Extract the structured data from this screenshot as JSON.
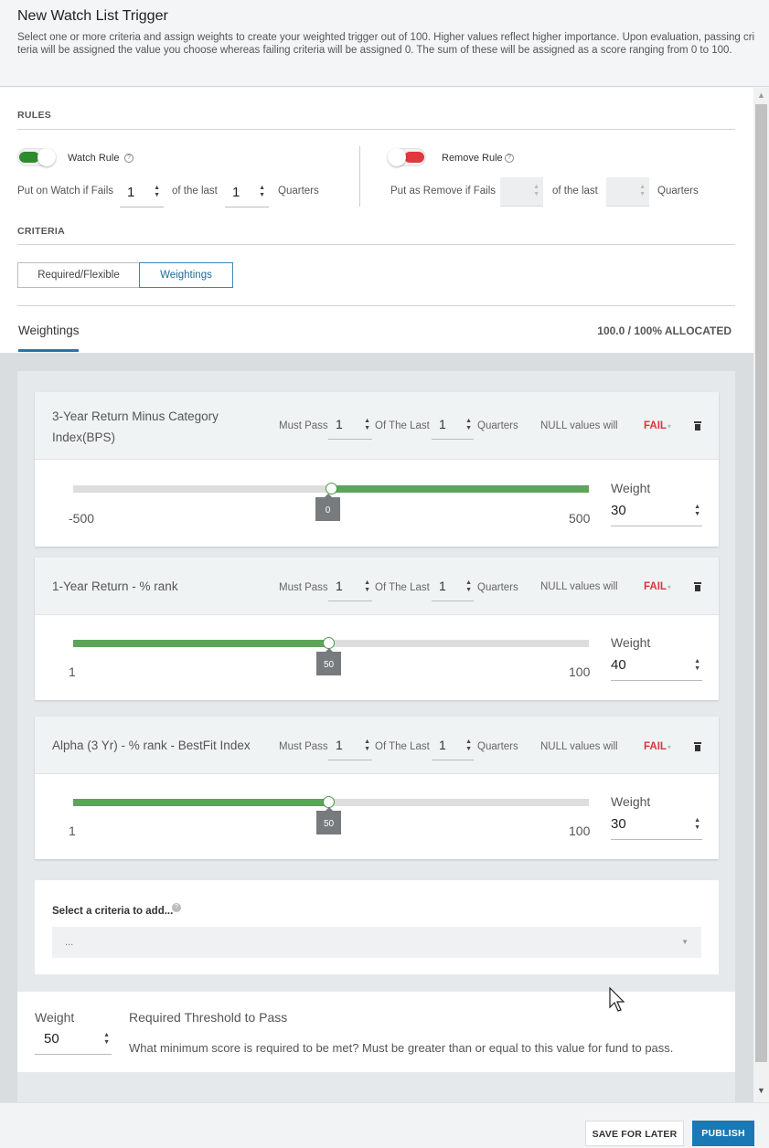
{
  "header": {
    "title": "New Watch List Trigger",
    "description": "Select one or more criteria and assign weights to create your weighted trigger out of 100. Higher values reflect higher importance. Upon evaluation, passing criteria will be assigned the value you choose whereas failing criteria will be assigned 0. The sum of these will be assigned as a score ranging from 0 to 100."
  },
  "rules": {
    "section_label": "RULES",
    "watch": {
      "label": "Watch Rule",
      "enabled": true,
      "prefix": "Put on Watch if Fails",
      "fails": "1",
      "middle": "of the last",
      "last": "1",
      "suffix": "Quarters"
    },
    "remove": {
      "label": "Remove Rule",
      "enabled": false,
      "prefix": "Put as Remove if Fails",
      "fails": "",
      "middle": "of the last",
      "last": "",
      "suffix": "Quarters"
    }
  },
  "criteria": {
    "section_label": "CRITERIA",
    "tabs": [
      "Required/Flexible",
      "Weightings"
    ],
    "active_tab": "Weightings"
  },
  "weightings": {
    "tab_label": "Weightings",
    "allocated": "100.0 / 100% ALLOCATED",
    "must_pass_label": "Must Pass",
    "of_the_last_label": "Of The Last",
    "quarters_label": "Quarters",
    "null_label": "NULL values will",
    "weight_label": "Weight",
    "items": [
      {
        "title": "3-Year Return Minus Category Index(BPS)",
        "must_pass": "1",
        "of_last": "1",
        "null_action": "FAIL",
        "min": "-500",
        "max": "500",
        "value": "0",
        "weight": "30"
      },
      {
        "title": "1-Year Return - % rank",
        "must_pass": "1",
        "of_last": "1",
        "null_action": "FAIL",
        "min": "1",
        "max": "100",
        "value": "50",
        "weight": "40"
      },
      {
        "title": "Alpha (3 Yr) - % rank - BestFit Index",
        "must_pass": "1",
        "of_last": "1",
        "null_action": "FAIL",
        "min": "1",
        "max": "100",
        "value": "50",
        "weight": "30"
      }
    ],
    "add": {
      "label": "Select a criteria to add...",
      "placeholder": "..."
    }
  },
  "threshold": {
    "weight_label": "Weight",
    "weight_value": "50",
    "title": "Required Threshold to Pass",
    "description": "What minimum score is required to be met? Must be greater than or equal to this value for fund to pass."
  },
  "footer": {
    "save_label": "SAVE FOR LATER",
    "publish_label": "PUBLISH"
  },
  "colors": {
    "accent": "#1a78b4",
    "on_toggle": "#2e8b2e",
    "off_toggle": "#e0393e",
    "slider_fill": "#5ea35a",
    "fail": "#d9363e"
  }
}
